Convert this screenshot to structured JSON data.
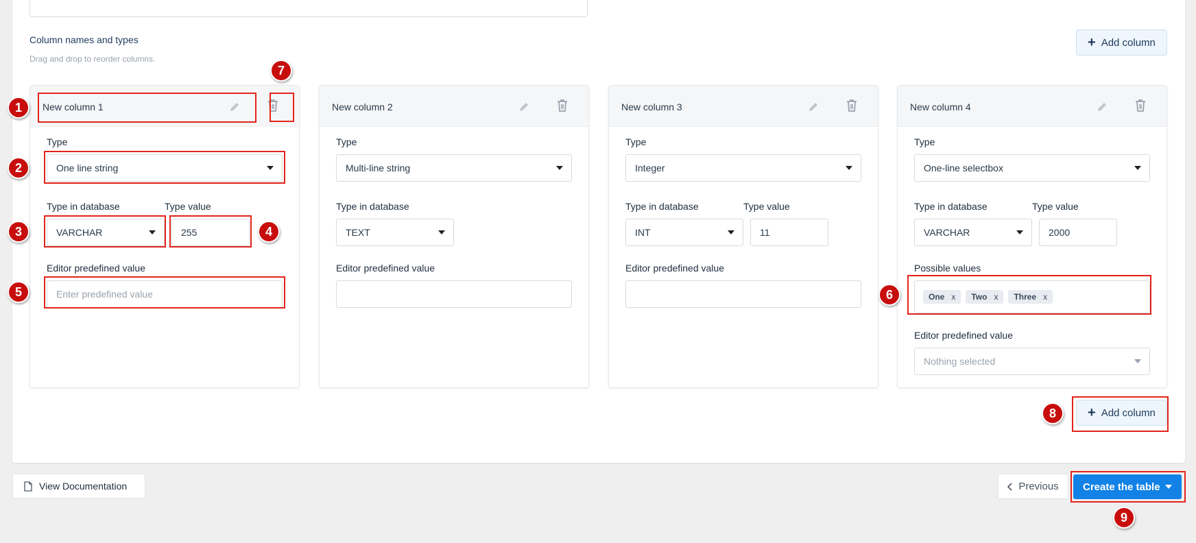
{
  "section": {
    "title": "Column names and types",
    "hint": "Drag and drop to reorder columns."
  },
  "add_column_label": "Add column",
  "labels": {
    "type": "Type",
    "type_in_db": "Type in database",
    "type_value": "Type value",
    "editor_predefined": "Editor predefined value",
    "possible_values": "Possible values"
  },
  "columns": [
    {
      "name": "New column 1",
      "type": "One line string",
      "db_type": "VARCHAR",
      "type_value": "255",
      "predefined_placeholder": "Enter predefined value"
    },
    {
      "name": "New column 2",
      "type": "Multi-line string",
      "db_type": "TEXT"
    },
    {
      "name": "New column 3",
      "type": "Integer",
      "db_type": "INT",
      "type_value": "11"
    },
    {
      "name": "New column 4",
      "type": "One-line selectbox",
      "db_type": "VARCHAR",
      "type_value": "2000",
      "possible_values": [
        "One",
        "Two",
        "Three"
      ],
      "tag_remove": "x",
      "predefined_select": "Nothing selected"
    }
  ],
  "footer": {
    "view_docs": "View Documentation",
    "previous": "Previous",
    "create": "Create the table"
  },
  "annotations": [
    "1",
    "2",
    "3",
    "4",
    "5",
    "6",
    "7",
    "8",
    "9"
  ],
  "colors": {
    "highlight": "#e2231a",
    "badge": "#c80d0d",
    "primary": "#1282e6"
  }
}
